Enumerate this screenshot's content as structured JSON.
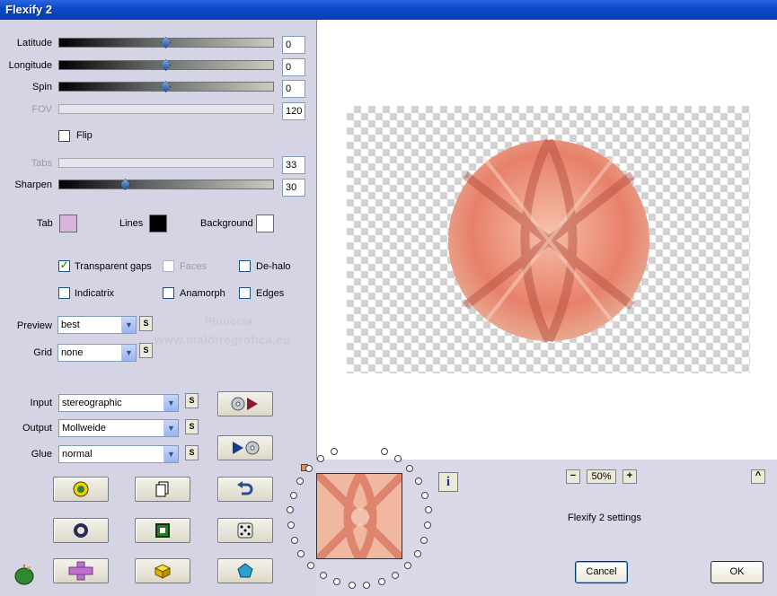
{
  "window": {
    "title": "Flexify 2"
  },
  "sliders": [
    {
      "label": "Latitude",
      "value": "0",
      "position": 0.5,
      "enabled": true
    },
    {
      "label": "Longitude",
      "value": "0",
      "position": 0.5,
      "enabled": true
    },
    {
      "label": "Spin",
      "value": "0",
      "position": 0.5,
      "enabled": true
    },
    {
      "label": "FOV",
      "value": "120",
      "position": null,
      "enabled": false
    },
    {
      "label": "Tabs",
      "value": "33",
      "position": null,
      "enabled": false
    },
    {
      "label": "Sharpen",
      "value": "30",
      "position": 0.3,
      "enabled": true
    }
  ],
  "flip": {
    "label": "Flip",
    "checked": false
  },
  "colors": {
    "tab": {
      "label": "Tab",
      "color": "#d8b4dc"
    },
    "lines": {
      "label": "Lines",
      "color": "#000000"
    },
    "background": {
      "label": "Background",
      "color": "#ffffff"
    }
  },
  "checkboxes": {
    "transparent_gaps": {
      "label": "Transparent gaps",
      "checked": true
    },
    "faces": {
      "label": "Faces",
      "checked": false,
      "enabled": false
    },
    "de_halo": {
      "label": "De-halo",
      "checked": false
    },
    "indicatrix": {
      "label": "Indicatrix",
      "checked": false
    },
    "anamorph": {
      "label": "Anamorph",
      "checked": false
    },
    "edges": {
      "label": "Edges",
      "checked": false
    }
  },
  "preview_select": {
    "label": "Preview",
    "value": "best"
  },
  "grid_select": {
    "label": "Grid",
    "value": "none"
  },
  "input_select": {
    "label": "Input",
    "value": "stereographic"
  },
  "output_select": {
    "label": "Output",
    "value": "Mollweide"
  },
  "glue_select": {
    "label": "Glue",
    "value": "normal"
  },
  "s_button_label": "S",
  "watermark": {
    "line1": "Pinuccia",
    "line2": "www.maldiregrafica.eu"
  },
  "zoom": {
    "minus": "−",
    "value": "50%",
    "plus": "+"
  },
  "collapse_label": "^",
  "info_label": "i",
  "status_text": "Flexify 2 settings",
  "buttons": {
    "cancel": "Cancel",
    "ok": "OK"
  },
  "accent_colors": {
    "title_bar": "#0a48c8",
    "sphere": "#e8806a",
    "panel": "#d4d4e4"
  }
}
